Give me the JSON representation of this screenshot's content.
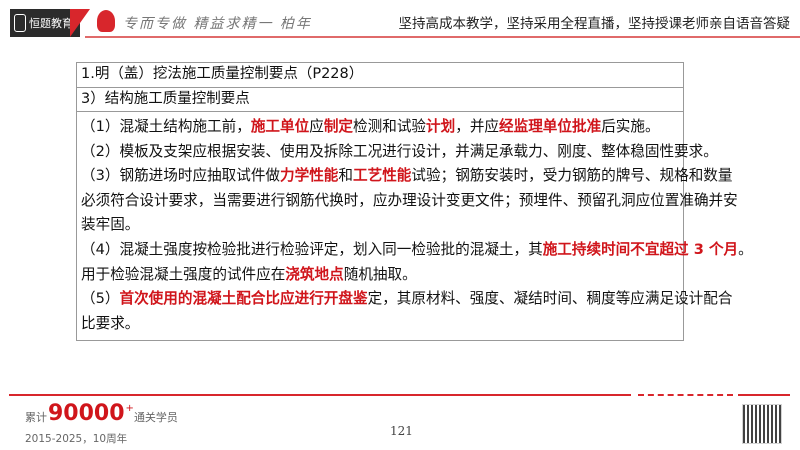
{
  "header": {
    "brand": "恒题教育",
    "script_slogan": "专而专做 精益求精一 柏年",
    "slogan": "坚持高成本教学，坚持采用全程直播，坚持授课老师亲自语音答疑"
  },
  "table": {
    "title": "1.明（盖）挖法施工质量控制要点（P228）",
    "subtitle": "3）结构施工质量控制要点",
    "lines": [
      [
        {
          "t": "（1）混凝土结构施工前，"
        },
        {
          "t": "施工单位",
          "r": true
        },
        {
          "t": "应"
        },
        {
          "t": "制定",
          "r": true
        },
        {
          "t": "检测和试验"
        },
        {
          "t": "计划",
          "r": true
        },
        {
          "t": "，并应"
        },
        {
          "t": "经监理单位批准",
          "r": true
        },
        {
          "t": "后实施。"
        }
      ],
      [
        {
          "t": "（2）模板及支架应根据安装、使用及拆除工况进行设计，并满足承载力、刚度、整体稳固性要求。"
        }
      ],
      [
        {
          "t": "（3）钢筋进场时应抽取试件做"
        },
        {
          "t": "力学性能",
          "r": true
        },
        {
          "t": "和"
        },
        {
          "t": "工艺性能",
          "r": true
        },
        {
          "t": "试验；钢筋安装时，受力钢筋的牌号、规格和数量"
        }
      ],
      [
        {
          "t": "必须符合设计要求，当需要进行钢筋代换时，应办理设计变更文件；预埋件、预留孔洞应位置准确并安"
        }
      ],
      [
        {
          "t": "装牢固。"
        }
      ],
      [
        {
          "t": "（4）混凝土强度按检验批进行检验评定，划入同一检验批的混凝土，其"
        },
        {
          "t": "施工持续时间不宜超过 3 个月",
          "r": true
        },
        {
          "t": "。"
        }
      ],
      [
        {
          "t": "用于检验混凝土强度的试件应在"
        },
        {
          "t": "浇筑地点",
          "r": true
        },
        {
          "t": "随机抽取。"
        }
      ],
      [
        {
          "t": "（5）"
        },
        {
          "t": "首次使用的混凝土配合比应进行开盘鉴",
          "r": true
        },
        {
          "t": "定，其原材料、强度、凝结时间、稠度等应满足设计配合"
        }
      ],
      [
        {
          "t": "比要求。"
        }
      ]
    ]
  },
  "footer": {
    "prefix": "累计",
    "count": "90000",
    "plus": "+",
    "suffix": "通关学员",
    "years": "2015-2025，10周年",
    "page_number": "121"
  },
  "colors": {
    "accent": "#d0151b",
    "brand_dark": "#2b2b2b"
  }
}
